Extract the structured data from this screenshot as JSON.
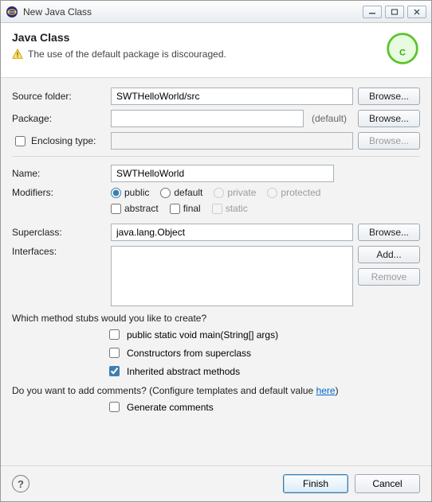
{
  "window": {
    "title": "New Java Class"
  },
  "banner": {
    "heading": "Java Class",
    "warning": "The use of the default package is discouraged."
  },
  "labels": {
    "sourceFolder": "Source folder:",
    "package": "Package:",
    "packageDefault": "(default)",
    "enclosingType": "Enclosing type:",
    "name": "Name:",
    "modifiers": "Modifiers:",
    "superclass": "Superclass:",
    "interfaces": "Interfaces:"
  },
  "values": {
    "sourceFolder": "SWTHelloWorld/src",
    "package": "",
    "enclosingType": "",
    "name": "SWTHelloWorld",
    "superclass": "java.lang.Object"
  },
  "modifiers": {
    "public": "public",
    "default": "default",
    "private": "private",
    "protected": "protected",
    "abstract": "abstract",
    "final": "final",
    "static": "static"
  },
  "buttons": {
    "browse": "Browse...",
    "add": "Add...",
    "remove": "Remove",
    "finish": "Finish",
    "cancel": "Cancel"
  },
  "stubs": {
    "question": "Which method stubs would you like to create?",
    "main": "public static void main(String[] args)",
    "constructors": "Constructors from superclass",
    "inherited": "Inherited abstract methods"
  },
  "comments": {
    "question_a": "Do you want to add comments? (Configure templates and default value ",
    "here": "here",
    "question_b": ")",
    "generate": "Generate comments"
  }
}
